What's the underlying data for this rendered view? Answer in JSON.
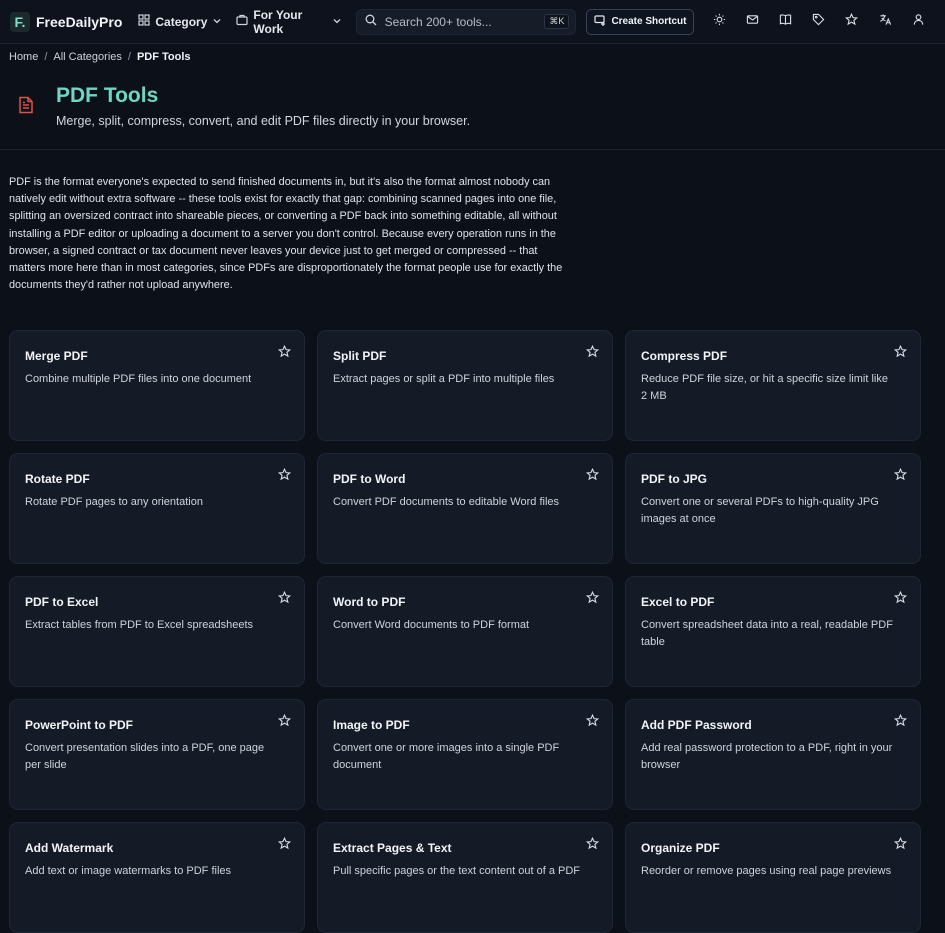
{
  "header": {
    "logo_mark": "F.",
    "logo_text": "FreeDailyPro",
    "category_label": "Category",
    "for_work_label": "For Your Work",
    "search_placeholder": "Search 200+ tools...",
    "search_shortcut": "⌘K",
    "create_shortcut_label": "Create Shortcut",
    "icons": [
      "theme-toggle-icon",
      "mail-icon",
      "book-icon",
      "tag-icon",
      "star-icon",
      "translate-icon",
      "user-icon"
    ]
  },
  "breadcrumb": {
    "home": "Home",
    "all_categories": "All Categories",
    "current": "PDF Tools"
  },
  "hero": {
    "title": "PDF Tools",
    "subtitle": "Merge, split, compress, convert, and edit PDF files directly in your browser.",
    "icon": "file-text-icon",
    "accent_color": "#6fd6c4",
    "icon_color": "#e0533f"
  },
  "intro": "PDF is the format everyone's expected to send finished documents in, but it's also the format almost nobody can natively edit without extra software -- these tools exist for exactly that gap: combining scanned pages into one file, splitting an oversized contract into shareable pieces, or converting a PDF back into something editable, all without installing a PDF editor or uploading a document to a server you don't control. Because every operation runs in the browser, a signed contract or tax document never leaves your device just to get merged or compressed -- that matters more here than in most categories, since PDFs are disproportionately the format people use for exactly the documents they'd rather not upload anywhere.",
  "tools": [
    {
      "title": "Merge PDF",
      "desc": "Combine multiple PDF files into one document"
    },
    {
      "title": "Split PDF",
      "desc": "Extract pages or split a PDF into multiple files"
    },
    {
      "title": "Compress PDF",
      "desc": "Reduce PDF file size, or hit a specific size limit like 2 MB"
    },
    {
      "title": "Rotate PDF",
      "desc": "Rotate PDF pages to any orientation"
    },
    {
      "title": "PDF to Word",
      "desc": "Convert PDF documents to editable Word files"
    },
    {
      "title": "PDF to JPG",
      "desc": "Convert one or several PDFs to high-quality JPG images at once"
    },
    {
      "title": "PDF to Excel",
      "desc": "Extract tables from PDF to Excel spreadsheets"
    },
    {
      "title": "Word to PDF",
      "desc": "Convert Word documents to PDF format"
    },
    {
      "title": "Excel to PDF",
      "desc": "Convert spreadsheet data into a real, readable PDF table"
    },
    {
      "title": "PowerPoint to PDF",
      "desc": "Convert presentation slides into a PDF, one page per slide"
    },
    {
      "title": "Image to PDF",
      "desc": "Convert one or more images into a single PDF document"
    },
    {
      "title": "Add PDF Password",
      "desc": "Add real password protection to a PDF, right in your browser"
    },
    {
      "title": "Add Watermark",
      "desc": "Add text or image watermarks to PDF files"
    },
    {
      "title": "Extract Pages & Text",
      "desc": "Pull specific pages or the text content out of a PDF"
    },
    {
      "title": "Organize PDF",
      "desc": "Reorder or remove pages using real page previews"
    }
  ]
}
